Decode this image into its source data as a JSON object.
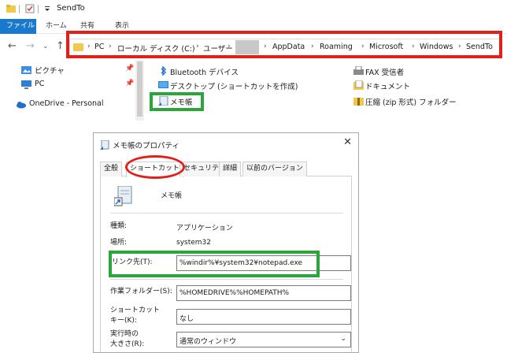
{
  "window": {
    "title": "SendTo"
  },
  "ribbon": {
    "tabs": [
      "ファイル",
      "ホーム",
      "共有",
      "表示"
    ]
  },
  "address": {
    "crumbs": [
      "PC",
      "ローカル ディスク (C:)",
      "ユーザー",
      "AppData",
      "Roaming",
      "Microsoft",
      "Windows",
      "SendTo"
    ]
  },
  "nav": {
    "items": [
      {
        "label": "ピクチャ",
        "icon": "pictures-folder-icon"
      },
      {
        "label": "PC",
        "icon": "pc-icon"
      },
      {
        "label": "OneDrive - Personal",
        "icon": "onedrive-icon"
      }
    ]
  },
  "files": {
    "items": [
      {
        "label": "Bluetooth デバイス",
        "icon": "bluetooth-icon"
      },
      {
        "label": "デスクトップ (ショートカットを作成)",
        "icon": "desktop-icon"
      },
      {
        "label": "メモ帳",
        "icon": "notepad-shortcut-icon"
      },
      {
        "label": "FAX 受信者",
        "icon": "fax-icon"
      },
      {
        "label": "ドキュメント",
        "icon": "documents-icon"
      },
      {
        "label": "圧縮 (zip 形式) フォルダー",
        "icon": "zip-folder-icon"
      }
    ]
  },
  "dialog": {
    "title": "メモ帳のプロパティ",
    "tabs": [
      "全般",
      "ショートカット",
      "セキュリティ",
      "詳細",
      "以前のバージョン"
    ],
    "app_name": "メモ帳",
    "type_label": "種類:",
    "type_value": "アプリケーション",
    "location_label": "場所:",
    "location_value": "system32",
    "target_label": "リンク先(T):",
    "target_value": "%windir%¥system32¥notepad.exe",
    "workdir_label": "作業フォルダー(S):",
    "workdir_value": "%HOMEDRIVE%%HOMEPATH%",
    "shortcut_key_label_1": "ショートカット",
    "shortcut_key_label_2": "キー(K):",
    "shortcut_key_value": "なし",
    "run_size_label_1": "実行時の",
    "run_size_label_2": "大きさ(R):",
    "run_size_value": "通常のウィンドウ"
  },
  "colors": {
    "annotation_red": "#e0201a",
    "annotation_green": "#2aa63a",
    "ribbon_file": "#1979ca"
  }
}
